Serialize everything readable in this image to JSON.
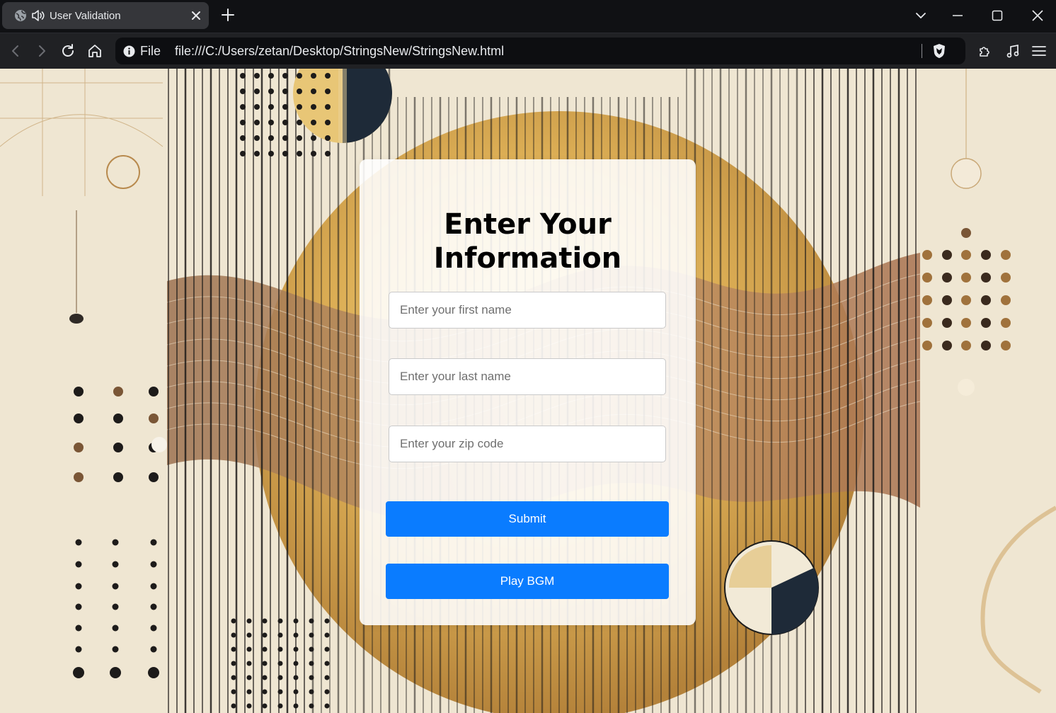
{
  "browser": {
    "tab_title": "User Validation",
    "scheme_label": "File",
    "url": "file:///C:/Users/zetan/Desktop/StringsNew/StringsNew.html"
  },
  "form": {
    "heading": "Enter Your Information",
    "first_name_placeholder": "Enter your first name",
    "last_name_placeholder": "Enter your last name",
    "zip_placeholder": "Enter your zip code",
    "submit_label": "Submit",
    "play_label": "Play BGM"
  },
  "colors": {
    "button": "#0a7cff",
    "chrome_dark": "#101114",
    "background": "#efe6d2",
    "gold": "#d8ab4e"
  }
}
